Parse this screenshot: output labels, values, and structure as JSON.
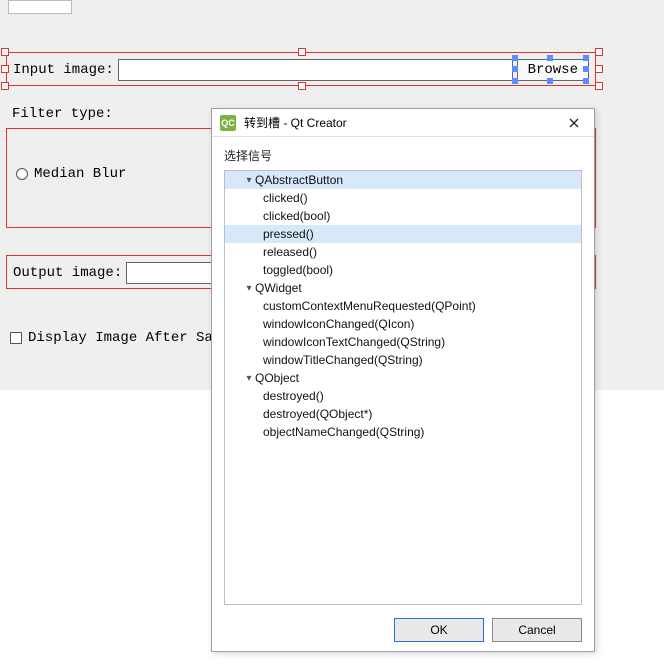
{
  "form": {
    "input_label": "Input image:",
    "browse_label": "Browse",
    "filter_label": "Filter type:",
    "median_label": "Median Blur",
    "output_label": "Output image:",
    "display_after_label": "Display Image After Sav"
  },
  "dialog": {
    "title": "转到槽 - Qt Creator",
    "section_label": "选择信号",
    "ok_label": "OK",
    "cancel_label": "Cancel",
    "groups": [
      {
        "name": "QAbstractButton",
        "selected": true,
        "signals": [
          {
            "name": "clicked()"
          },
          {
            "name": "clicked(bool)"
          },
          {
            "name": "pressed()",
            "selected": true
          },
          {
            "name": "released()"
          },
          {
            "name": "toggled(bool)"
          }
        ]
      },
      {
        "name": "QWidget",
        "signals": [
          {
            "name": "customContextMenuRequested(QPoint)"
          },
          {
            "name": "windowIconChanged(QIcon)"
          },
          {
            "name": "windowIconTextChanged(QString)"
          },
          {
            "name": "windowTitleChanged(QString)"
          }
        ]
      },
      {
        "name": "QObject",
        "signals": [
          {
            "name": "destroyed()"
          },
          {
            "name": "destroyed(QObject*)"
          },
          {
            "name": "objectNameChanged(QString)"
          }
        ]
      }
    ]
  }
}
